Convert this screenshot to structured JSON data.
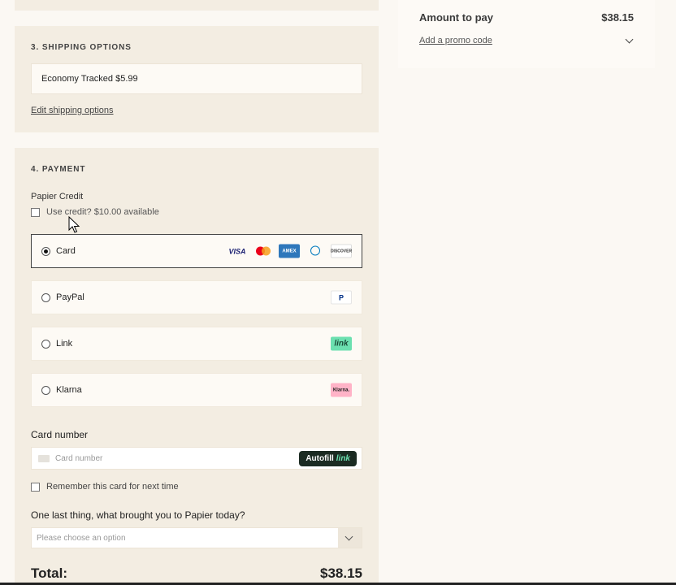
{
  "summary": {
    "amount_label": "Amount to pay",
    "amount_value": "$38.15",
    "promo_label": "Add a promo code"
  },
  "shipping": {
    "title": "3. SHIPPING OPTIONS",
    "selected_option": "Economy Tracked $5.99",
    "edit_label": "Edit shipping options"
  },
  "payment": {
    "title": "4. PAYMENT",
    "credit_label": "Papier Credit",
    "credit_checkbox": "Use credit? $10.00 available",
    "methods": [
      {
        "label": "Card",
        "selected": true
      },
      {
        "label": "PayPal",
        "selected": false
      },
      {
        "label": "Link",
        "selected": false
      },
      {
        "label": "Klarna",
        "selected": false
      }
    ],
    "card_logos": {
      "visa": "VISA",
      "amex": "AMEX",
      "discover": "DISCOVER"
    },
    "paypal_logo": "P",
    "link_logo": "link",
    "klarna_logo": "Klarna.",
    "card_number_label": "Card number",
    "card_number_placeholder": "Card number",
    "autofill_label": "Autofill",
    "autofill_link": "link",
    "remember_label": "Remember this card for next time",
    "question": "One last thing, what brought you to Papier today?",
    "select_placeholder": "Please choose an option"
  },
  "total": {
    "label": "Total:",
    "value": "$38.15"
  }
}
